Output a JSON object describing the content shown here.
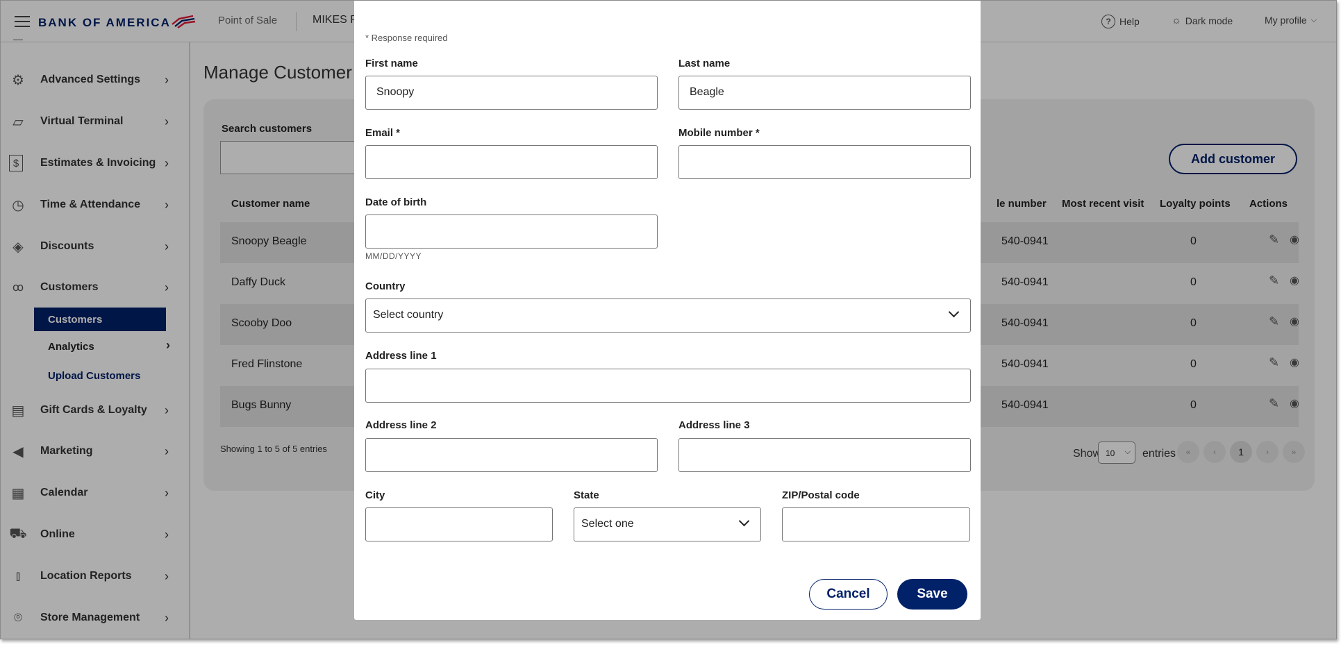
{
  "header": {
    "brand": "BANK OF AMERICA",
    "app_name": "Point of Sale",
    "merchant": "MIKES P",
    "help": "Help",
    "dark_mode": "Dark mode",
    "profile": "My profile"
  },
  "sidebar": {
    "items": [
      {
        "label": "Advanced Settings",
        "icon": "gear-icon"
      },
      {
        "label": "Virtual Terminal",
        "icon": "terminal-icon"
      },
      {
        "label": "Estimates & Invoicing",
        "icon": "invoice-icon"
      },
      {
        "label": "Time & Attendance",
        "icon": "clock-icon"
      },
      {
        "label": "Discounts",
        "icon": "tag-icon"
      },
      {
        "label": "Customers",
        "icon": "users-icon"
      },
      {
        "label": "Gift Cards & Loyalty",
        "icon": "gift-card-icon"
      },
      {
        "label": "Marketing",
        "icon": "megaphone-icon"
      },
      {
        "label": "Calendar",
        "icon": "calendar-icon"
      },
      {
        "label": "Online",
        "icon": "cart-icon"
      },
      {
        "label": "Location Reports",
        "icon": "bar-chart-icon"
      },
      {
        "label": "Store Management",
        "icon": "location-pin-icon"
      }
    ],
    "sub_items": {
      "customers": "Customers",
      "analytics": "Analytics",
      "upload": "Upload Customers"
    }
  },
  "main": {
    "title": "Manage Customer",
    "search_label": "Search customers",
    "add_button": "Add customer",
    "columns": {
      "name": "Customer name",
      "mobile": "le number",
      "recent": "Most recent visit",
      "loyalty": "Loyalty points",
      "actions": "Actions"
    },
    "rows": [
      {
        "name": "Snoopy Beagle",
        "mobile": "540-0941",
        "recent": "",
        "points": "0"
      },
      {
        "name": "Daffy Duck",
        "mobile": "540-0941",
        "recent": "",
        "points": "0"
      },
      {
        "name": "Scooby Doo",
        "mobile": "540-0941",
        "recent": "",
        "points": "0"
      },
      {
        "name": "Fred Flinstone",
        "mobile": "540-0941",
        "recent": "",
        "points": "0"
      },
      {
        "name": "Bugs Bunny",
        "mobile": "540-0941",
        "recent": "",
        "points": "0"
      }
    ],
    "showing": "Showing 1 to 5 of 5 entries",
    "show_label": "Show",
    "page_size": "10",
    "entries_label": "entries",
    "pagination": {
      "first": "«",
      "prev": "‹",
      "current": "1",
      "next": "›",
      "last": "»"
    }
  },
  "modal": {
    "required_note": "* Response required",
    "first_name_label": "First name",
    "first_name_value": "Snoopy",
    "last_name_label": "Last name",
    "last_name_value": "Beagle",
    "email_label": "Email *",
    "email_value": "",
    "mobile_label": "Mobile number *",
    "mobile_value": "",
    "dob_label": "Date of birth",
    "dob_value": "",
    "dob_hint": "MM/DD/YYYY",
    "country_label": "Country",
    "country_value": "Select country",
    "address1_label": "Address line 1",
    "address1_value": "",
    "address2_label": "Address line 2",
    "address2_value": "",
    "address3_label": "Address line 3",
    "address3_value": "",
    "city_label": "City",
    "city_value": "",
    "state_label": "State",
    "state_value": "Select one",
    "zip_label": "ZIP/Postal code",
    "zip_value": "",
    "cancel": "Cancel",
    "save": "Save"
  },
  "colors": {
    "brand_navy": "#012169",
    "brand_red": "#e31837"
  }
}
